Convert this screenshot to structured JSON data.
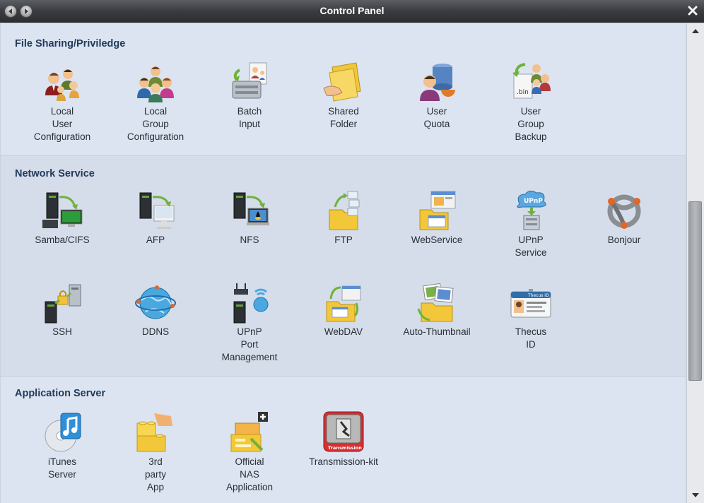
{
  "window": {
    "title": "Control Panel"
  },
  "sections": [
    {
      "title": "File Sharing/Priviledge",
      "items": [
        {
          "label": "Local\nUser\nConfiguration",
          "icon": "users-icon"
        },
        {
          "label": "Local\nGroup\nConfiguration",
          "icon": "group-icon"
        },
        {
          "label": "Batch\nInput",
          "icon": "batch-input-icon"
        },
        {
          "label": "Shared\nFolder",
          "icon": "shared-folder-icon"
        },
        {
          "label": "User\nQuota",
          "icon": "user-quota-icon"
        },
        {
          "label": "User\nGroup\nBackup",
          "icon": "backup-icon"
        }
      ]
    },
    {
      "title": "Network Service",
      "items": [
        {
          "label": "Samba/CIFS",
          "icon": "samba-icon"
        },
        {
          "label": "AFP",
          "icon": "afp-icon"
        },
        {
          "label": "NFS",
          "icon": "nfs-icon"
        },
        {
          "label": "FTP",
          "icon": "ftp-icon"
        },
        {
          "label": "WebService",
          "icon": "webservice-icon"
        },
        {
          "label": "UPnP\nService",
          "icon": "upnp-icon"
        },
        {
          "label": "Bonjour",
          "icon": "bonjour-icon"
        },
        {
          "label": "SSH",
          "icon": "ssh-icon"
        },
        {
          "label": "DDNS",
          "icon": "ddns-icon"
        },
        {
          "label": "UPnP\nPort\nManagement",
          "icon": "upnp-port-icon"
        },
        {
          "label": "WebDAV",
          "icon": "webdav-icon"
        },
        {
          "label": "Auto-Thumbnail",
          "icon": "thumbnail-icon"
        },
        {
          "label": "Thecus\nID",
          "icon": "thecus-id-icon",
          "badge": "Thecus ID"
        }
      ]
    },
    {
      "title": "Application Server",
      "items": [
        {
          "label": "iTunes\nServer",
          "icon": "itunes-icon"
        },
        {
          "label": "3rd\nparty\nApp",
          "icon": "lego-icon"
        },
        {
          "label": "Official\nNAS\nApplication",
          "icon": "nas-app-icon"
        },
        {
          "label": "Transmission-kit",
          "icon": "transmission-icon",
          "badge": "Transmission"
        }
      ]
    }
  ]
}
